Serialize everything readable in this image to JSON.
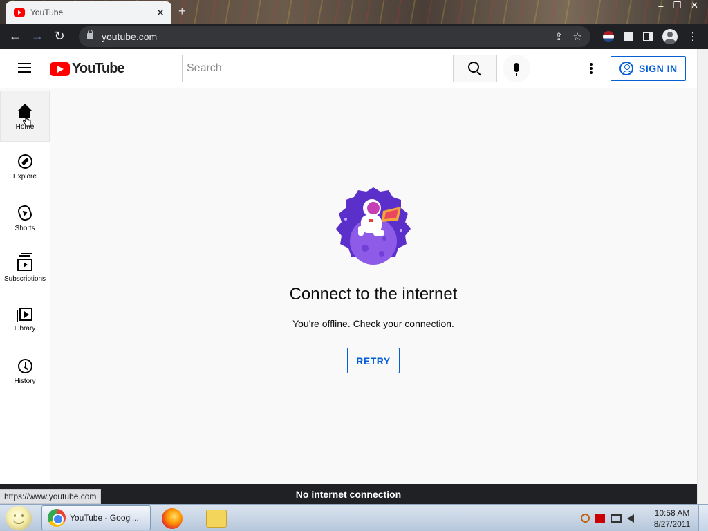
{
  "browser": {
    "tab_title": "YouTube",
    "tab_close": "✕",
    "new_tab": "+",
    "url": "youtube.com",
    "status_url": "https://www.youtube.com"
  },
  "header": {
    "logo_text": "YouTube",
    "search_placeholder": "Search",
    "sign_in_label": "SIGN IN"
  },
  "sidebar": {
    "items": [
      {
        "label": "Home",
        "icon": "home-icon",
        "active": true
      },
      {
        "label": "Explore",
        "icon": "compass-icon"
      },
      {
        "label": "Shorts",
        "icon": "shorts-icon"
      },
      {
        "label": "Subscriptions",
        "icon": "subscriptions-icon"
      },
      {
        "label": "Library",
        "icon": "library-icon"
      },
      {
        "label": "History",
        "icon": "history-icon"
      }
    ]
  },
  "main": {
    "title": "Connect to the internet",
    "message": "You're offline. Check your connection.",
    "retry_label": "RETRY",
    "banner": "No internet connection"
  },
  "taskbar": {
    "chrome_label": "YouTube - Googl...",
    "time": "10:58 AM",
    "date": "8/27/2011"
  },
  "colors": {
    "accent": "#065fd4",
    "brand_red": "#ff0000",
    "page_bg": "#f9f9f9",
    "toolbar_bg": "#202124"
  }
}
